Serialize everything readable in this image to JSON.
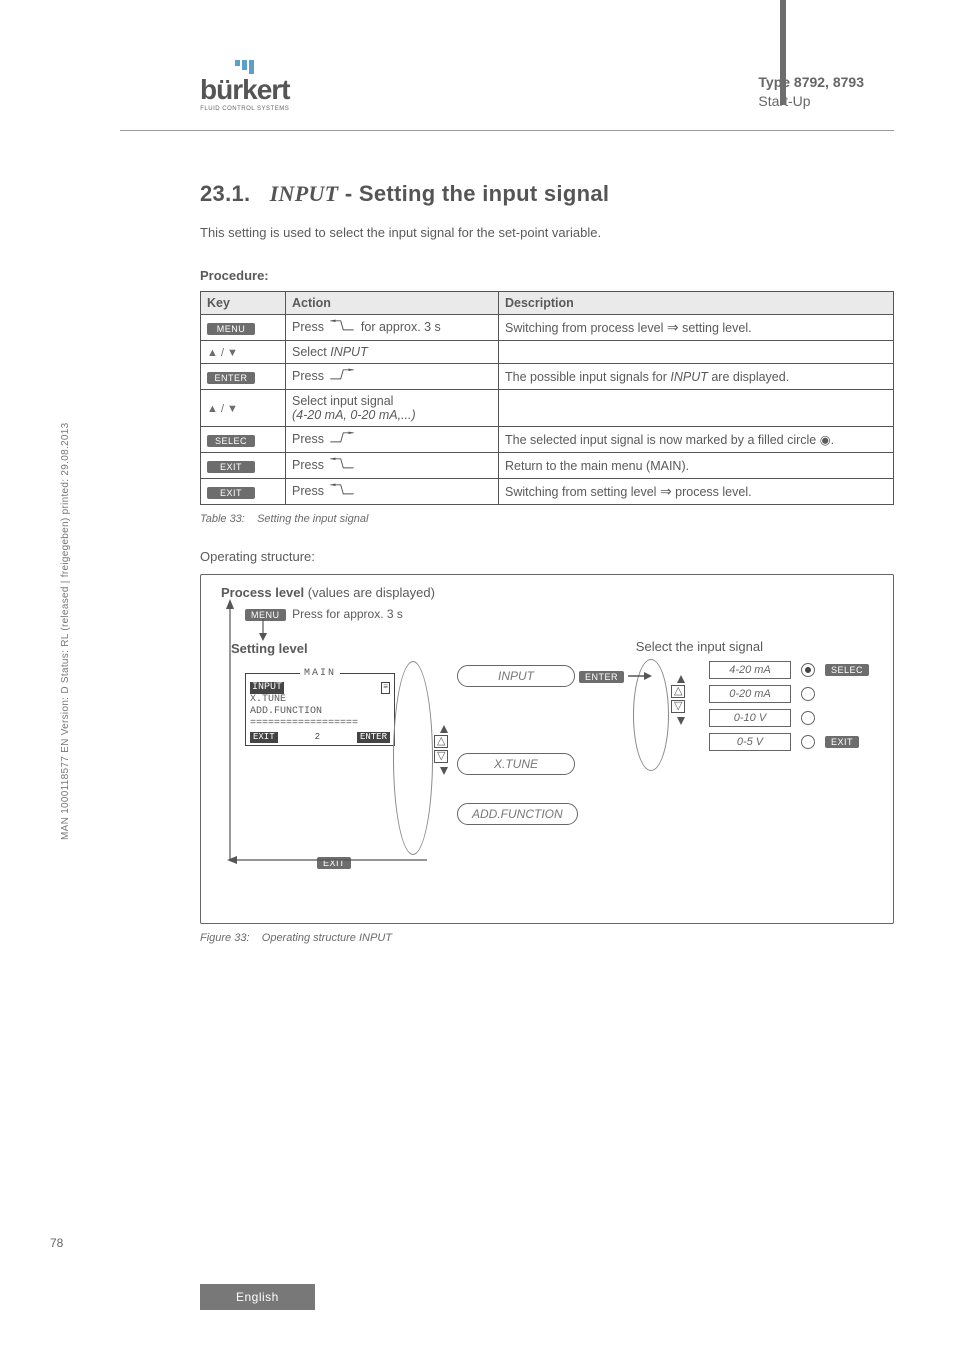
{
  "header": {
    "logo_word_pre": "b",
    "logo_word_post": "rkert",
    "logo_sub": "FLUID CONTROL SYSTEMS",
    "type_label": "Type 8792, 8793",
    "chapter": "Start-Up"
  },
  "sidebar_meta": "MAN 1000118577 EN Version: D Status: RL (released | freigegeben) printed: 29.08.2013",
  "section": {
    "number": "23.1.",
    "title_em": "INPUT",
    "title_rest": " - Setting the input signal",
    "intro": "This setting is used to select the input signal for the set-point variable.",
    "procedure_label": "Procedure:"
  },
  "table": {
    "headers": {
      "key": "Key",
      "action": "Action",
      "description": "Description"
    },
    "rows": [
      {
        "key_label": "MENU",
        "key_type": "btn",
        "action_pre": "Press ",
        "action_icon": "left",
        "action_post": " for approx. 3 s",
        "desc_pre": "Switching from process level ",
        "desc_arrow": "⇒",
        "desc_post": " setting level."
      },
      {
        "key_type": "tri",
        "action_plain": "Select ",
        "action_em": "INPUT",
        "desc": ""
      },
      {
        "key_label": "ENTER",
        "key_type": "btn",
        "action_pre": "Press ",
        "action_icon": "right",
        "desc_pre": "The possible input signals for ",
        "desc_em": "INPUT",
        "desc_post2": " are displayed."
      },
      {
        "key_type": "tri",
        "action_line1": "Select input signal",
        "action_line2": "(4-20 mA, 0-20 mA,...)",
        "desc": ""
      },
      {
        "key_label": "SELEC",
        "key_type": "btn",
        "action_pre": "Press ",
        "action_icon": "right",
        "desc_plain": "The selected input signal is now marked by a filled circle ",
        "desc_dot": "◉",
        "desc_end": "."
      },
      {
        "key_label": "EXIT",
        "key_type": "btn",
        "action_pre": "Press ",
        "action_icon": "left",
        "desc_plain2": "Return to the main menu (MAIN)."
      },
      {
        "key_label": "EXIT",
        "key_type": "btn",
        "action_pre": "Press ",
        "action_icon": "left",
        "desc_pre": "Switching from setting level ",
        "desc_arrow": "⇒",
        "desc_post": " process level."
      }
    ],
    "caption_pre": "Table 33:",
    "caption_txt": "Setting the input signal"
  },
  "operating": {
    "label": "Operating structure:",
    "process_level_pre": "Process level",
    "process_level_post": " (values are displayed)",
    "menu_instr": "Press for approx. 3 s",
    "setting_level": "Setting level",
    "select_signal": "Select the input signal",
    "lcd": {
      "title": "MAIN",
      "items": [
        "INPUT",
        "X.TUNE",
        "ADD.FUNCTION",
        "=================="
      ],
      "foot_left": "EXIT",
      "foot_mid": "2",
      "foot_right": "ENTER"
    },
    "nodes": {
      "input": "INPUT",
      "xtune": "X.TUNE",
      "addfunc": "ADD.FUNCTION"
    },
    "enter_tag": "ENTER",
    "options": [
      "4-20 mA",
      "0-20 mA",
      "0-10 V",
      "0-5 V"
    ],
    "selec_tag": "SELEC",
    "exit_tag": "EXIT",
    "exit_tag2": "EXIT",
    "figure_pre": "Figure 33:",
    "figure_txt": "Operating structure INPUT"
  },
  "footer": {
    "page": "78",
    "lang": "English"
  }
}
